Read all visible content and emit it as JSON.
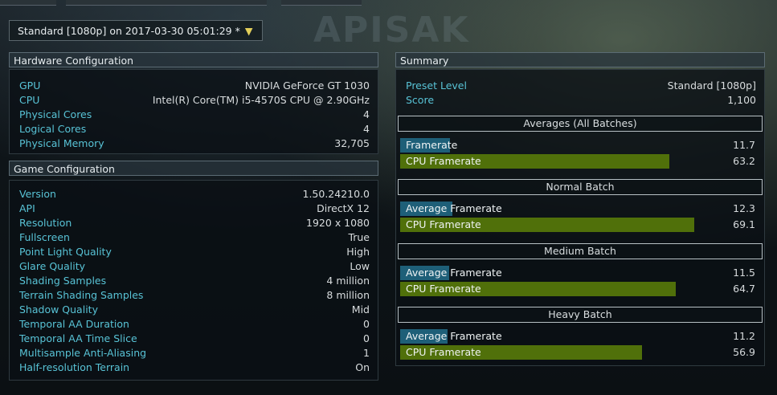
{
  "preset_dropdown": {
    "label": "Standard [1080p] on 2017-03-30 05:01:29 *",
    "arrow": "▼"
  },
  "watermark": "APISAK",
  "hardware": {
    "title": "Hardware Configuration",
    "rows": [
      {
        "key": "GPU",
        "value": "NVIDIA GeForce GT 1030"
      },
      {
        "key": "CPU",
        "value": "Intel(R) Core(TM) i5-4570S CPU @ 2.90GHz"
      },
      {
        "key": "Physical Cores",
        "value": "4"
      },
      {
        "key": "Logical Cores",
        "value": "4"
      },
      {
        "key": "Physical Memory",
        "value": "32,705"
      }
    ]
  },
  "game": {
    "title": "Game Configuration",
    "rows": [
      {
        "key": "Version",
        "value": "1.50.24210.0"
      },
      {
        "key": "API",
        "value": "DirectX 12"
      },
      {
        "key": "Resolution",
        "value": "1920 x 1080"
      },
      {
        "key": "Fullscreen",
        "value": "True"
      },
      {
        "key": "Point Light Quality",
        "value": "High"
      },
      {
        "key": "Glare Quality",
        "value": "Low"
      },
      {
        "key": "Shading Samples",
        "value": "4 million"
      },
      {
        "key": "Terrain Shading Samples",
        "value": "8 million"
      },
      {
        "key": "Shadow Quality",
        "value": "Mid"
      },
      {
        "key": "Temporal AA Duration",
        "value": "0"
      },
      {
        "key": "Temporal AA Time Slice",
        "value": "0"
      },
      {
        "key": "Multisample Anti-Aliasing",
        "value": "1"
      },
      {
        "key": "Half-resolution Terrain",
        "value": "On"
      }
    ]
  },
  "summary": {
    "title": "Summary",
    "rows": [
      {
        "key": "Preset Level",
        "value": "Standard [1080p]"
      },
      {
        "key": "Score",
        "value": "1,100"
      }
    ],
    "bar_scale_max": 69.1,
    "batches": [
      {
        "title": "Averages (All Batches)",
        "bars": [
          {
            "label": "Framerate",
            "value": "11.7",
            "num": 11.7,
            "kind": "blue"
          },
          {
            "label": "CPU Framerate",
            "value": "63.2",
            "num": 63.2,
            "kind": "green"
          }
        ]
      },
      {
        "title": "Normal Batch",
        "bars": [
          {
            "label": "Average Framerate",
            "value": "12.3",
            "num": 12.3,
            "kind": "blue"
          },
          {
            "label": "CPU Framerate",
            "value": "69.1",
            "num": 69.1,
            "kind": "green"
          }
        ]
      },
      {
        "title": "Medium Batch",
        "bars": [
          {
            "label": "Average Framerate",
            "value": "11.5",
            "num": 11.5,
            "kind": "blue"
          },
          {
            "label": "CPU Framerate",
            "value": "64.7",
            "num": 64.7,
            "kind": "green"
          }
        ]
      },
      {
        "title": "Heavy Batch",
        "bars": [
          {
            "label": "Average Framerate",
            "value": "11.2",
            "num": 11.2,
            "kind": "blue"
          },
          {
            "label": "CPU Framerate",
            "value": "56.9",
            "num": 56.9,
            "kind": "green"
          }
        ]
      }
    ]
  }
}
